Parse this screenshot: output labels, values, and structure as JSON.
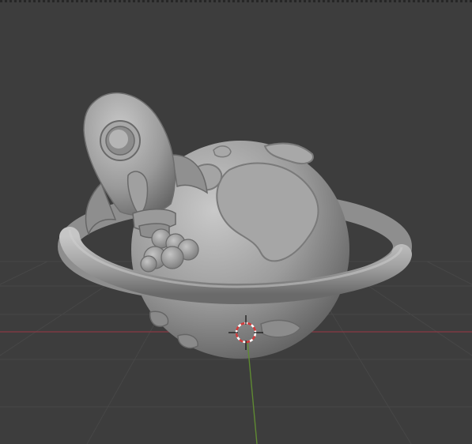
{
  "viewport": {
    "background_color": "#3d3d3d",
    "grid_line_color": "#4a4a4a",
    "x_axis_color": "#8a3a44",
    "y_axis_color": "#5f8a32",
    "model_base_color": "#9a9a9a",
    "model_highlight_color": "#c4c4c4",
    "model_shadow_color": "#5a5a5a",
    "cursor_icon": "3d-cursor-icon",
    "model_name": "planet-with-rocket-sculpt"
  }
}
